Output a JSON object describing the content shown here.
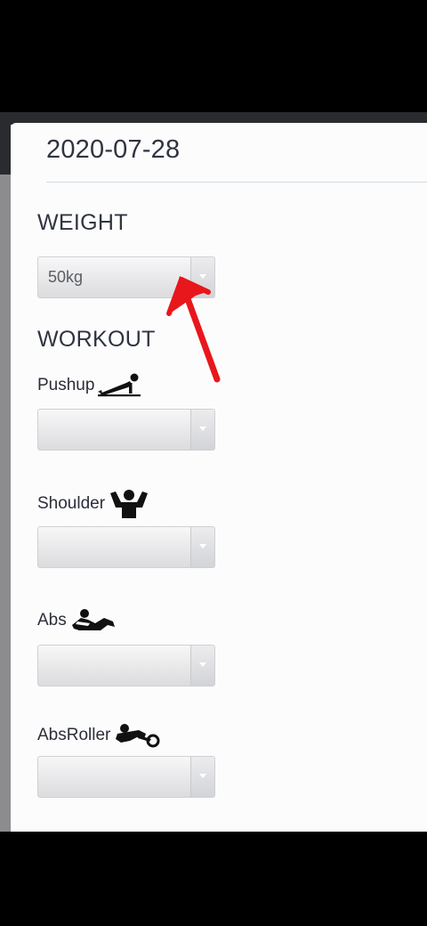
{
  "date": "2020-07-28",
  "weight": {
    "heading": "WEIGHT",
    "select_value": "50kg"
  },
  "workout": {
    "heading": "WORKOUT",
    "items": [
      {
        "label": "Pushup",
        "icon": "pushup-icon",
        "select_value": ""
      },
      {
        "label": "Shoulder",
        "icon": "shoulder-icon",
        "select_value": ""
      },
      {
        "label": "Abs",
        "icon": "situp-icon",
        "select_value": ""
      },
      {
        "label": "AbsRoller",
        "icon": "ab-roller-icon",
        "select_value": ""
      }
    ]
  },
  "colors": {
    "annotation_arrow": "#e8171b",
    "text": "#2f3440"
  }
}
